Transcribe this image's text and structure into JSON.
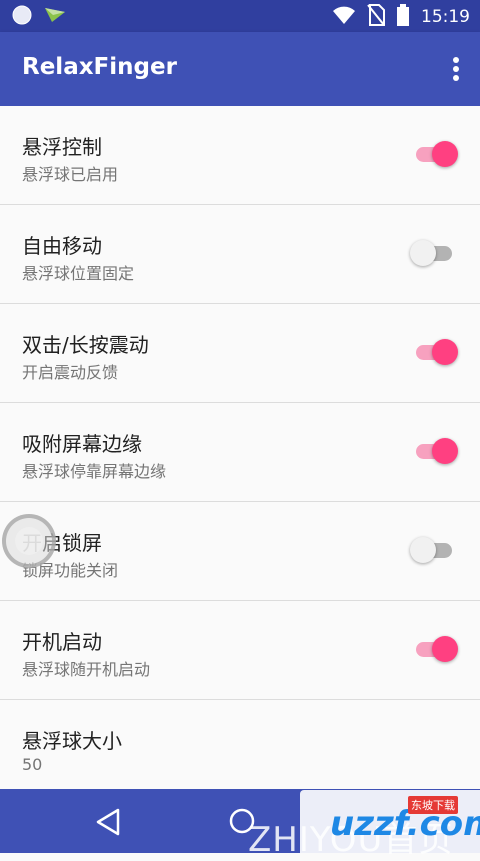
{
  "status_bar": {
    "time": "15:19",
    "icons": [
      "circle-notification-icon",
      "send-notification-icon",
      "wifi-icon",
      "no-sim-icon",
      "battery-icon"
    ]
  },
  "app_bar": {
    "title": "RelaxFinger",
    "more_icon": "more-vert-icon",
    "color": "#3f51b5"
  },
  "settings": [
    {
      "title": "悬浮控制",
      "summary": "悬浮球已启用",
      "enabled": true
    },
    {
      "title": "自由移动",
      "summary": "悬浮球位置固定",
      "enabled": false
    },
    {
      "title": "双击/长按震动",
      "summary": "开启震动反馈",
      "enabled": true
    },
    {
      "title": "吸附屏幕边缘",
      "summary": "悬浮球停靠屏幕边缘",
      "enabled": true
    },
    {
      "title": "开启锁屏",
      "summary": "锁屏功能关闭",
      "enabled": false
    },
    {
      "title": "开机启动",
      "summary": "悬浮球随开机启动",
      "enabled": true
    },
    {
      "title": "悬浮球大小",
      "summary": "50"
    }
  ],
  "colors": {
    "accent": "#ff4081",
    "primary_dark": "#303f9f"
  },
  "nav_bar": {
    "back_icon": "back-triangle-icon",
    "home_icon": "home-circle-icon"
  },
  "watermark": {
    "text": "ZHIYOU首页",
    "brand": "uzzf.com",
    "tag": "东坡下载"
  }
}
